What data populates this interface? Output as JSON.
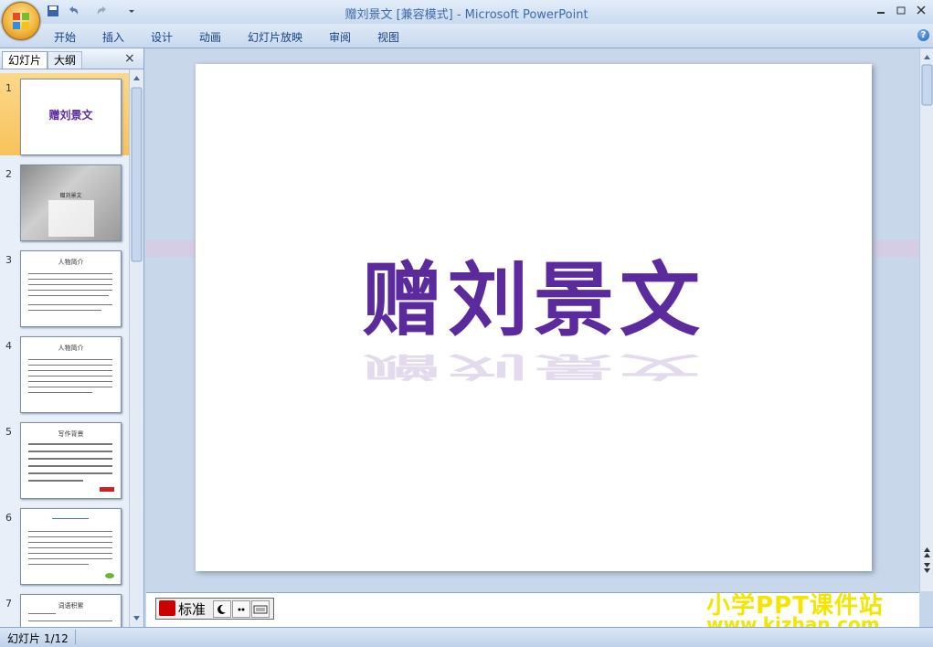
{
  "window": {
    "title": "赠刘景文 [兼容模式] - Microsoft PowerPoint",
    "controls": [
      "minimize",
      "restore",
      "close"
    ]
  },
  "ribbon": {
    "tabs": [
      "开始",
      "插入",
      "设计",
      "动画",
      "幻灯片放映",
      "审阅",
      "视图"
    ],
    "help": "?"
  },
  "left_panel": {
    "tabs": [
      "幻灯片",
      "大纲"
    ],
    "close": "×",
    "slides": [
      {
        "number": "1",
        "title": "赠刘景文",
        "selected": true
      },
      {
        "number": "2",
        "title": "赠刘景文"
      },
      {
        "number": "3",
        "title": "人物简介"
      },
      {
        "number": "4",
        "title": "人物简介"
      },
      {
        "number": "5",
        "title": "写作背景"
      },
      {
        "number": "6",
        "title": ""
      },
      {
        "number": "7",
        "title": "词语积累"
      }
    ]
  },
  "slide": {
    "title": "赠刘景文"
  },
  "ime": {
    "mode": "标准"
  },
  "status": {
    "text": "幻灯片 1/12"
  },
  "watermark": {
    "line1": "小学PPT课件站",
    "line2": "www.kjzhan.com"
  }
}
